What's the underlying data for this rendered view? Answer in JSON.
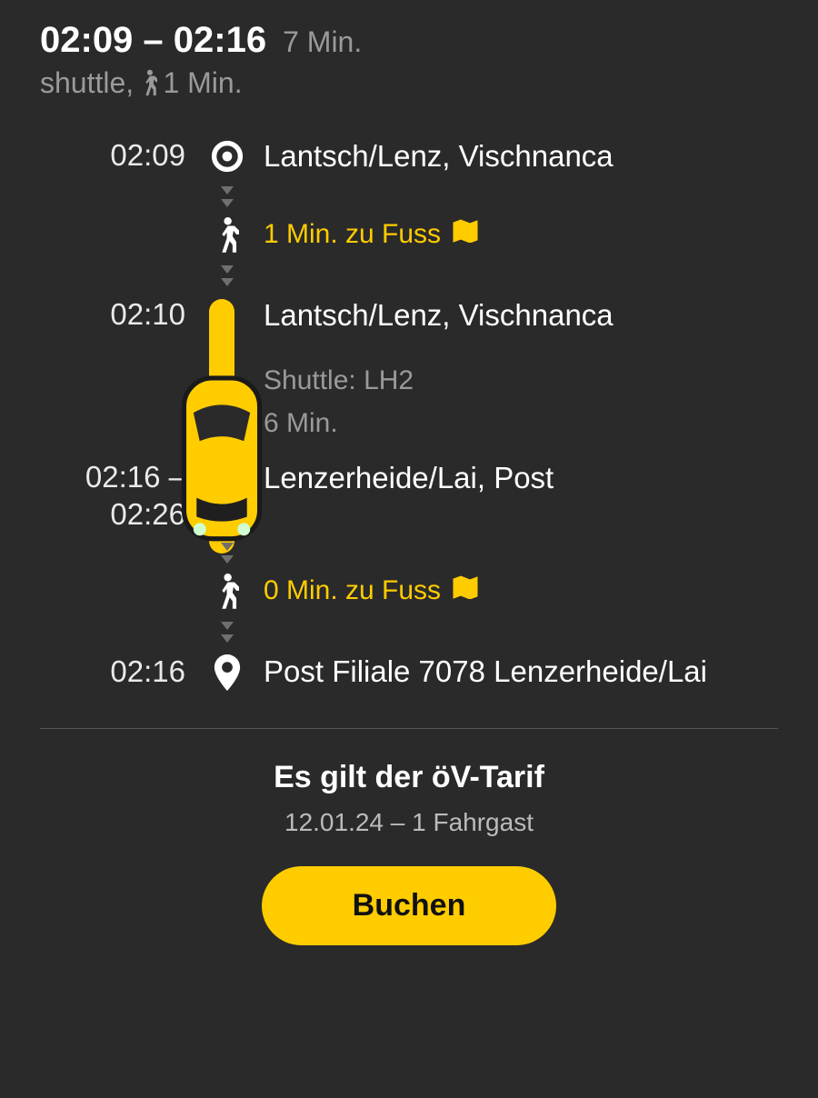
{
  "header": {
    "time_range": "02:09 – 02:16",
    "duration": "7 Min.",
    "mode": "shuttle,",
    "walk_short": "1 Min."
  },
  "segments": {
    "origin": {
      "time": "02:09",
      "name": "Lantsch/Lenz, Vischnanca"
    },
    "walk1": {
      "text": "1 Min. zu Fuss"
    },
    "shuttle_start": {
      "time": "02:10",
      "name": "Lantsch/Lenz, Vischnanca"
    },
    "shuttle_info": {
      "line": "Shuttle: LH2",
      "dur": "6 Min."
    },
    "shuttle_end": {
      "time": "02:16 – 02:26",
      "name": "Lenzerheide/Lai, Post"
    },
    "walk2": {
      "text": "0 Min. zu Fuss"
    },
    "dest": {
      "time": "02:16",
      "name": "Post Filiale 7078 Lenzerheide/Lai"
    }
  },
  "fare": {
    "title": "Es gilt der öV-Tarif",
    "sub": "12.01.24 – 1 Fahrgast"
  },
  "button": {
    "label": "Buchen"
  }
}
